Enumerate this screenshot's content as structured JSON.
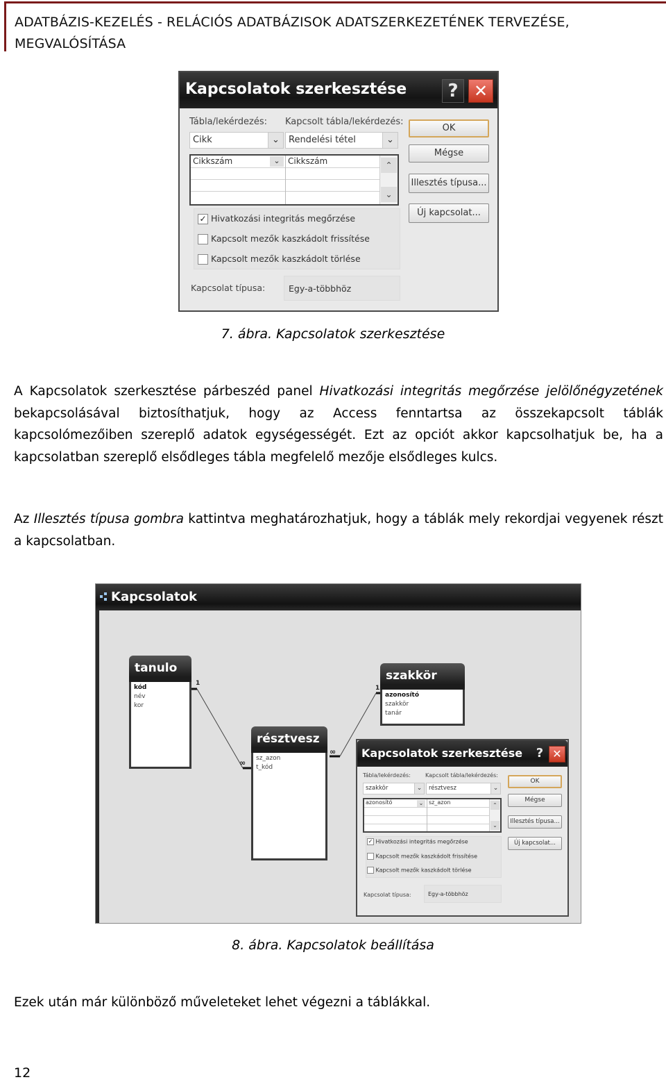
{
  "header": {
    "title_line1": "ADATBÁZIS-KEZELÉS - RELÁCIÓS ADATBÁZISOK ADATSZERKEZETÉNEK TERVEZÉSE,",
    "title_line2": "MEGVALÓSÍTÁSA",
    "accent_color": "#7a1a1a"
  },
  "figure7": {
    "caption": "7. ábra. Kapcsolatok szerkesztése",
    "dialog": {
      "title": "Kapcsolatok szerkesztése",
      "help_icon": "?",
      "close_icon": "✕",
      "table_label": "Tábla/lekérdezés:",
      "related_table_label": "Kapcsolt tábla/lekérdezés:",
      "table_value": "Cikk",
      "related_table_value": "Rendelési tétel",
      "field_rows": [
        {
          "left": "Cikkszám",
          "right": "Cikkszám"
        },
        {
          "left": "",
          "right": ""
        },
        {
          "left": "",
          "right": ""
        }
      ],
      "buttons": {
        "ok": "OK",
        "cancel": "Mégse",
        "join_type": "Illesztés típusa...",
        "new_relation": "Új kapcsolat..."
      },
      "checkboxes": [
        {
          "label": "Hivatkozási integritás megőrzése",
          "checked": true
        },
        {
          "label": "Kapcsolt mezők kaszkádolt frissítése",
          "checked": false
        },
        {
          "label": "Kapcsolt mezők kaszkádolt törlése",
          "checked": false
        }
      ],
      "relation_type_label": "Kapcsolat típusa:",
      "relation_type_value": "Egy-a-többhöz"
    }
  },
  "body": {
    "para1": {
      "t1": "A Kapcsolatok szerkesztése párbeszéd panel ",
      "em1": "Hivatkozási integritás megőrzése jelölőnégyzetének",
      "t2": " bekapcsolásával biztosíthatjuk, hogy az Access fenntartsa az összekapcsolt táblák kapcsolómezőiben szereplő adatok egységességét. Ezt az opciót akkor kapcsolhatjuk be, ha a kapcsolatban szereplő elsődleges tábla megfelelő mezője elsődleges kulcs."
    },
    "para2": {
      "t1": "Az ",
      "em1": "Illesztés típusa gombra",
      "t2": " kattintva meghatározhatjuk, hogy a táblák mely rekordjai vegyenek részt a kapcsolatban."
    },
    "para3": "Ezek után már különböző műveleteket lehet végezni a táblákkal."
  },
  "figure8": {
    "caption": "8. ábra. Kapcsolatok beállítása",
    "window_title": "Kapcsolatok",
    "tables": [
      {
        "name": "tanulo",
        "fields": [
          "kód",
          "név",
          "kor"
        ],
        "primary_key": "kód"
      },
      {
        "name": "szakkör",
        "fields": [
          "azonosító",
          "szakkör",
          "tanár"
        ],
        "primary_key": "azonosító"
      },
      {
        "name": "résztvesz",
        "fields": [
          "sz_azon",
          "t_kód"
        ],
        "primary_key": ""
      }
    ],
    "relations": [
      {
        "from": "tanulo.kód",
        "to": "résztvesz.t_kód",
        "from_card": "1",
        "to_card": "∞"
      },
      {
        "from": "szakkör.azonosító",
        "to": "résztvesz.sz_azon",
        "from_card": "1",
        "to_card": "∞"
      }
    ],
    "dialog": {
      "title": "Kapcsolatok szerkesztése",
      "help_icon": "?",
      "close_icon": "✕",
      "table_label": "Tábla/lekérdezés:",
      "related_table_label": "Kapcsolt tábla/lekérdezés:",
      "table_value": "szakkör",
      "related_table_value": "résztvesz",
      "field_rows": [
        {
          "left": "azonosító",
          "right": "sz_azon"
        },
        {
          "left": "",
          "right": ""
        },
        {
          "left": "",
          "right": ""
        }
      ],
      "buttons": {
        "ok": "OK",
        "cancel": "Mégse",
        "join_type": "Illesztés típusa...",
        "new_relation": "Új kapcsolat..."
      },
      "checkboxes": [
        {
          "label": "Hivatkozási integritás megőrzése",
          "checked": true
        },
        {
          "label": "Kapcsolt mezők kaszkádolt frissítése",
          "checked": false
        },
        {
          "label": "Kapcsolt mezők kaszkádolt törlése",
          "checked": false
        }
      ],
      "relation_type_label": "Kapcsolat típusa:",
      "relation_type_value": "Egy-a-többhöz"
    }
  },
  "footer": {
    "page_number": "12"
  }
}
